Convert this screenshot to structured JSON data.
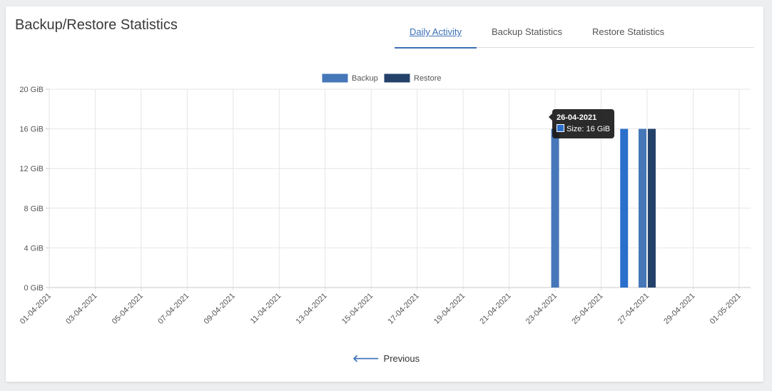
{
  "card": {
    "title": "Backup/Restore Statistics"
  },
  "tabs": [
    {
      "label": "Daily Activity",
      "active": true
    },
    {
      "label": "Backup Statistics",
      "active": false
    },
    {
      "label": "Restore Statistics",
      "active": false
    }
  ],
  "chart_data": {
    "type": "bar",
    "x_tick_labels": [
      "01-04-2021",
      "03-04-2021",
      "05-04-2021",
      "07-04-2021",
      "09-04-2021",
      "11-04-2021",
      "13-04-2021",
      "15-04-2021",
      "17-04-2021",
      "19-04-2021",
      "21-04-2021",
      "23-04-2021",
      "25-04-2021",
      "27-04-2021",
      "29-04-2021",
      "01-05-2021"
    ],
    "y_tick_labels": [
      "0 GiB",
      "4 GiB",
      "8 GiB",
      "12 GiB",
      "16 GiB",
      "20 GiB"
    ],
    "ylim": [
      0,
      20
    ],
    "y_unit": "GiB",
    "grid": true,
    "legend_position": "top",
    "series": [
      {
        "name": "Backup",
        "color": "#4577b9",
        "highlight_color": "#2a6fcb",
        "points": [
          {
            "date": "23-04-2021",
            "value": 16
          },
          {
            "date": "26-04-2021",
            "value": 16
          },
          {
            "date": "27-04-2021",
            "value": 16
          }
        ]
      },
      {
        "name": "Restore",
        "color": "#24416a",
        "points": [
          {
            "date": "27-04-2021",
            "value": 16
          }
        ]
      }
    ]
  },
  "tooltip": {
    "title": "26-04-2021",
    "body": "Size: 16 GiB"
  },
  "pagination": {
    "previous_label": "Previous",
    "previous_icon": "arrow-left-icon"
  }
}
